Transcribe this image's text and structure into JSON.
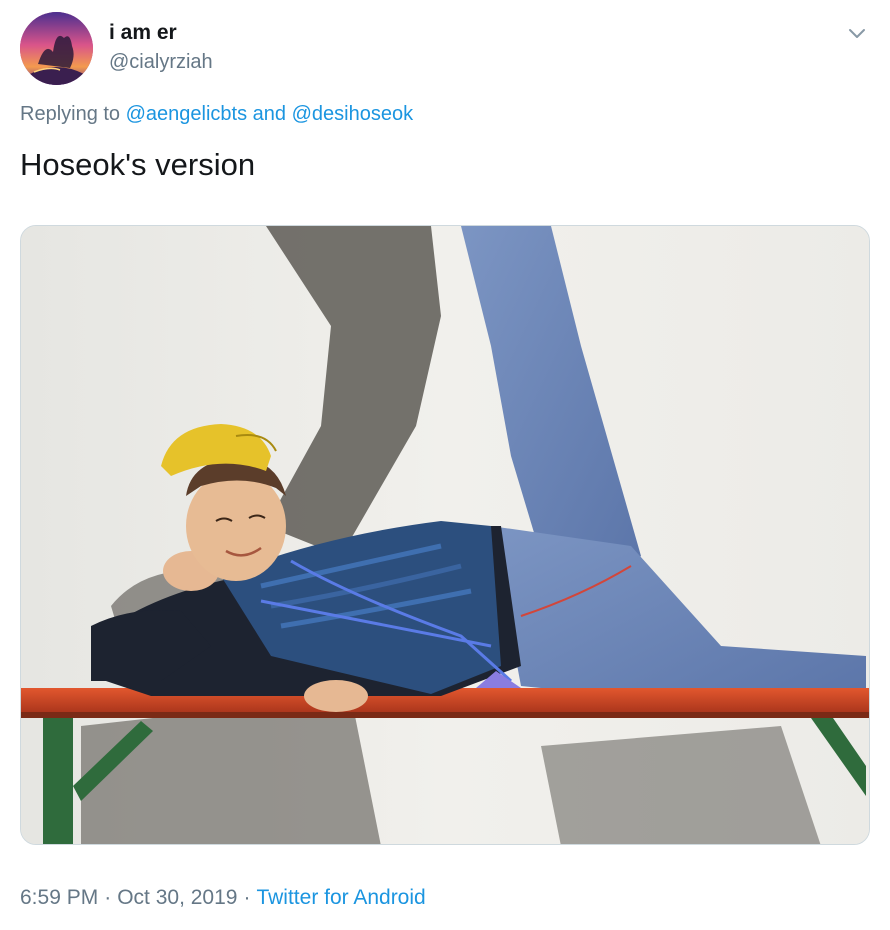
{
  "tweet": {
    "author": {
      "display_name": "i am er",
      "handle": "@cialyrziah",
      "avatar_icon": "profile-avatar"
    },
    "reply": {
      "prefix": "Replying to",
      "mention_1": "@aengelicbts",
      "conjunction": "and",
      "mention_2": "@desihoseok"
    },
    "text": "Hoseok's version",
    "media": {
      "type": "photo"
    },
    "footer": {
      "time": "6:59 PM",
      "separator_1": "·",
      "date": "Oct 30, 2019",
      "separator_2": "·",
      "source": "Twitter for Android"
    },
    "menu_icon": "chevron-down-icon"
  },
  "colors": {
    "link": "#1b95e0",
    "secondary_text": "#657786",
    "primary_text": "#14171a",
    "border": "#cfd9de"
  }
}
